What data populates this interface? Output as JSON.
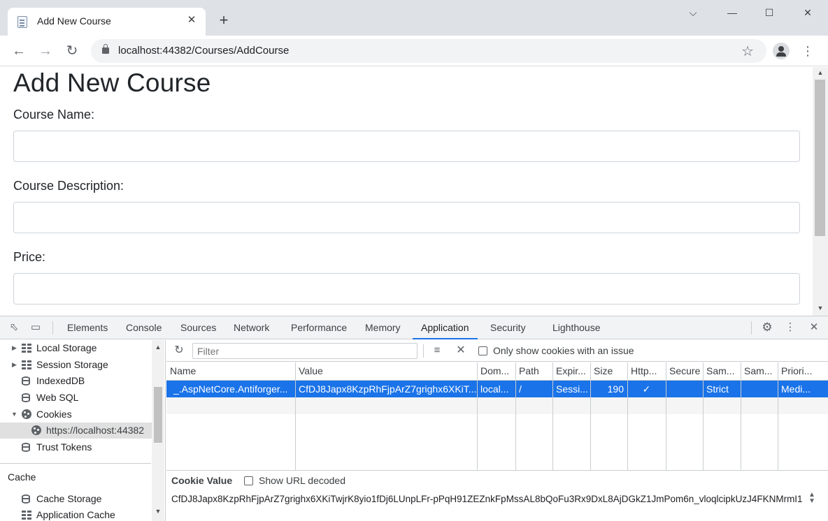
{
  "browser": {
    "tab_title": "Add New Course",
    "tab_close_glyph": "✕",
    "new_tab_glyph": "+",
    "window_controls": {
      "dropdown": "⌵",
      "minimize": "—",
      "maximize": "☐",
      "close": "✕"
    },
    "url": "localhost:44382/Courses/AddCourse"
  },
  "page": {
    "heading": "Add New Course",
    "fields": [
      {
        "label": "Course Name:",
        "value": "",
        "placeholder": ""
      },
      {
        "label": "Course Description:",
        "value": "",
        "placeholder": ""
      },
      {
        "label": "Price:",
        "value": "",
        "placeholder": ""
      }
    ]
  },
  "devtools": {
    "tabs": [
      "Elements",
      "Console",
      "Sources",
      "Network",
      "Performance",
      "Memory",
      "Application",
      "Security",
      "Lighthouse"
    ],
    "active_tab": "Application",
    "sidebar": {
      "items": [
        {
          "label": "Local Storage",
          "icon": "grid-icon",
          "expanded": false
        },
        {
          "label": "Session Storage",
          "icon": "grid-icon",
          "expanded": false
        },
        {
          "label": "IndexedDB",
          "icon": "database-icon"
        },
        {
          "label": "Web SQL",
          "icon": "database-icon"
        },
        {
          "label": "Cookies",
          "icon": "cookie-icon",
          "expanded": true
        },
        {
          "label": "https://localhost:44382",
          "icon": "cookie-icon",
          "selected": true
        },
        {
          "label": "Trust Tokens",
          "icon": "database-icon"
        }
      ],
      "cache_section": "Cache",
      "cache_items": [
        {
          "label": "Cache Storage",
          "icon": "database-icon"
        },
        {
          "label": "Application Cache",
          "icon": "grid-icon"
        }
      ]
    },
    "toolbar": {
      "filter_placeholder": "Filter",
      "only_issues_label": "Only show cookies with an issue"
    },
    "table": {
      "columns": [
        "Name",
        "Value",
        "Dom...",
        "Path",
        "Expir...",
        "Size",
        "Http...",
        "Secure",
        "Sam...",
        "Sam...",
        "Priori..."
      ],
      "rows": [
        [
          "_.AspNetCore.Antiforger...",
          "CfDJ8Japx8KzpRhFjpArZ7grighx6XKiT...",
          "local...",
          "/",
          "Sessi...",
          "190",
          "✓",
          "",
          "Strict",
          "",
          "Medi..."
        ]
      ]
    },
    "cookie_value": {
      "title": "Cookie Value",
      "show_decoded_label": "Show URL decoded",
      "value": "CfDJ8Japx8KzpRhFjpArZ7grighx6XKiTwjrK8yio1fDj6LUnpLFr-pPqH91ZEZnkFpMssAL8bQoFu3Rx9DxL8AjDGkZ1JmPom6n_vloqlcipkUzJ4FKNMrmI1"
    }
  },
  "colors": {
    "accent": "#1a73e8",
    "tabstrip": "#dee1e6",
    "devtools_toolbar": "#f1f3f4"
  }
}
